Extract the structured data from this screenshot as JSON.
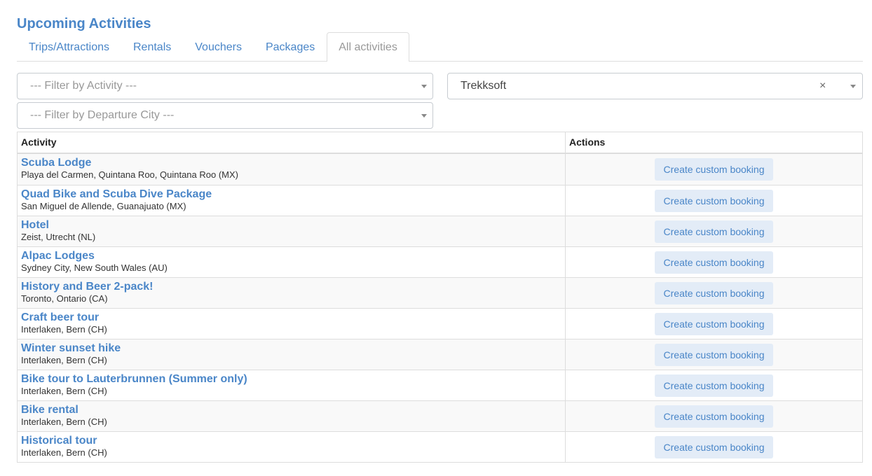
{
  "page": {
    "title": "Upcoming Activities"
  },
  "tabs": [
    {
      "label": "Trips/Attractions",
      "active": false
    },
    {
      "label": "Rentals",
      "active": false
    },
    {
      "label": "Vouchers",
      "active": false
    },
    {
      "label": "Packages",
      "active": false
    },
    {
      "label": "All activities",
      "active": true
    }
  ],
  "filters": {
    "activity_placeholder": "--- Filter by Activity ---",
    "departure_city_placeholder": "--- Filter by Departure City ---",
    "provider_value": "Trekksoft",
    "clear_symbol": "×"
  },
  "table": {
    "headers": {
      "activity": "Activity",
      "actions": "Actions"
    },
    "action_label": "Create custom booking",
    "rows": [
      {
        "name": "Scuba Lodge",
        "location": "Playa del Carmen, Quintana Roo, Quintana Roo (MX)"
      },
      {
        "name": "Quad Bike and Scuba Dive Package",
        "location": "San Miguel de Allende, Guanajuato (MX)"
      },
      {
        "name": "Hotel",
        "location": "Zeist, Utrecht (NL)"
      },
      {
        "name": "Alpac Lodges",
        "location": "Sydney City, New South Wales (AU)"
      },
      {
        "name": "History and Beer 2-pack!",
        "location": "Toronto, Ontario (CA)"
      },
      {
        "name": "Craft beer tour",
        "location": "Interlaken, Bern (CH)"
      },
      {
        "name": "Winter sunset hike",
        "location": "Interlaken, Bern (CH)"
      },
      {
        "name": "Bike tour to Lauterbrunnen (Summer only)",
        "location": "Interlaken, Bern (CH)"
      },
      {
        "name": "Bike rental",
        "location": "Interlaken, Bern (CH)"
      },
      {
        "name": "Historical tour",
        "location": "Interlaken, Bern (CH)"
      }
    ]
  },
  "colors": {
    "link": "#4a86c8",
    "button_bg": "#e3ecf7",
    "stripe": "#f9f9f9",
    "border": "#dddddd"
  },
  "icons": {
    "dropdown": "caret-down-icon",
    "clear": "clear-icon"
  }
}
